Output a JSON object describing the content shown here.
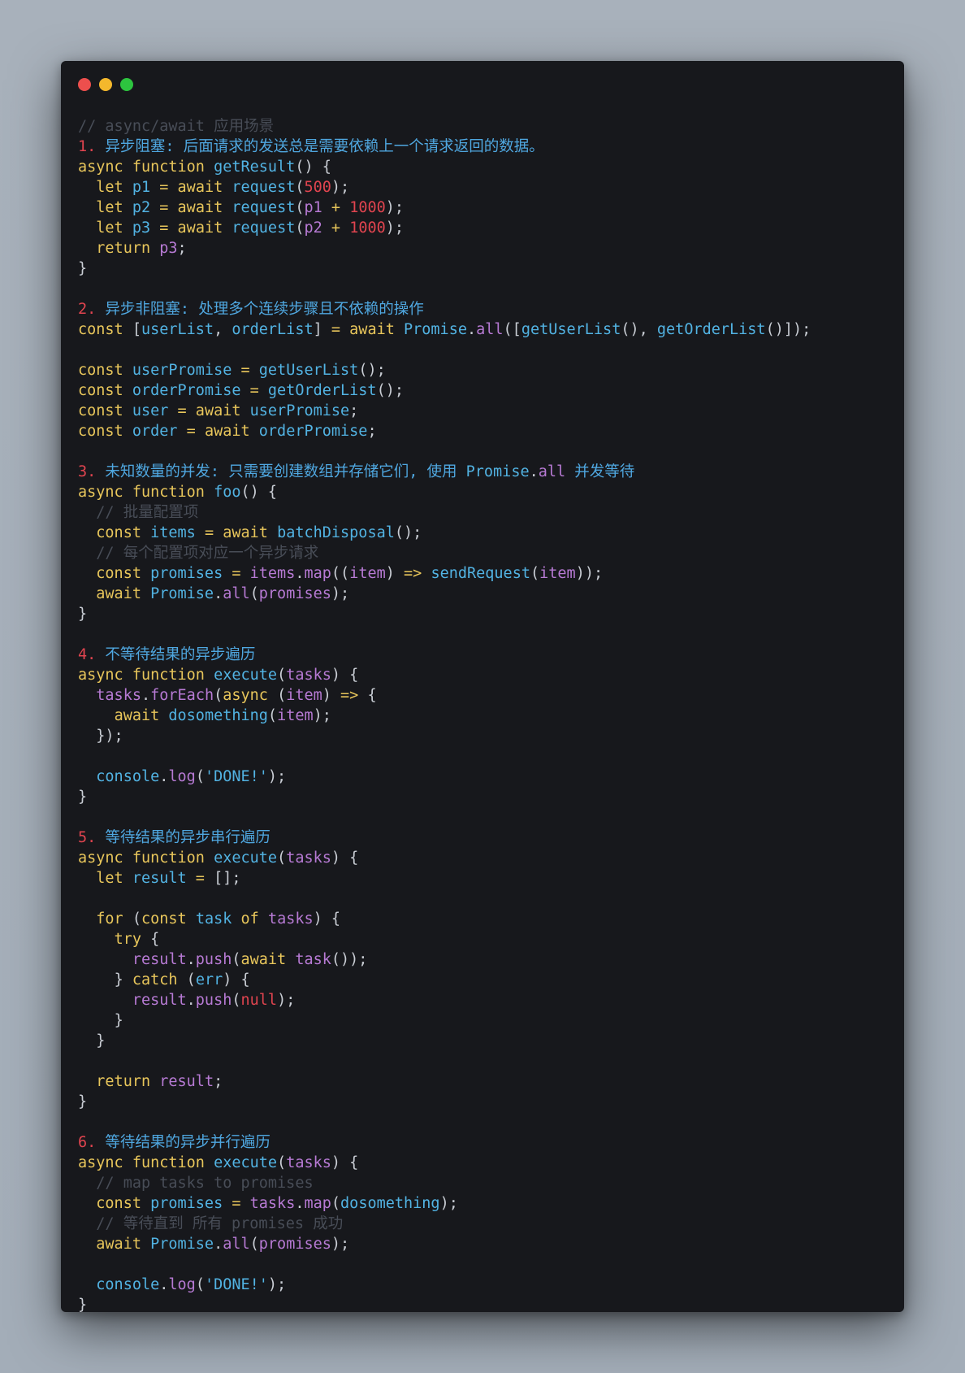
{
  "window": {
    "controls": [
      {
        "name": "close-button",
        "color": "#ed4f4d"
      },
      {
        "name": "minimize-button",
        "color": "#f4b82c"
      },
      {
        "name": "maximize-button",
        "color": "#2dc43f"
      }
    ]
  },
  "colors": {
    "background": "#a6b0ba",
    "editor": "#17181c",
    "comment": "#484d57",
    "keyword": "#e8c65b",
    "function": "#52b3e3",
    "variable": "#b77ad4",
    "number": "#e0444f",
    "heading": "#4fa7e0",
    "string": "#52b3e3",
    "plain": "#c9cdd4"
  },
  "code_lines": [
    [
      [
        "comment",
        "// async/await 应用场景"
      ]
    ],
    [
      [
        "number",
        "1. "
      ],
      [
        "heading",
        "异步阻塞: 后面请求的发送总是需要依赖上一个请求返回的数据。"
      ]
    ],
    [
      [
        "keyword",
        "async function "
      ],
      [
        "function",
        "getResult"
      ],
      [
        "punct",
        "() {"
      ]
    ],
    [
      [
        "plain",
        "  "
      ],
      [
        "keyword",
        "let "
      ],
      [
        "function",
        "p1"
      ],
      [
        "keyword",
        " = await "
      ],
      [
        "function",
        "request"
      ],
      [
        "punct",
        "("
      ],
      [
        "number",
        "500"
      ],
      [
        "punct",
        ");"
      ]
    ],
    [
      [
        "plain",
        "  "
      ],
      [
        "keyword",
        "let "
      ],
      [
        "function",
        "p2"
      ],
      [
        "keyword",
        " = await "
      ],
      [
        "function",
        "request"
      ],
      [
        "punct",
        "("
      ],
      [
        "variable",
        "p1"
      ],
      [
        "keyword",
        " + "
      ],
      [
        "number",
        "1000"
      ],
      [
        "punct",
        ");"
      ]
    ],
    [
      [
        "plain",
        "  "
      ],
      [
        "keyword",
        "let "
      ],
      [
        "function",
        "p3"
      ],
      [
        "keyword",
        " = await "
      ],
      [
        "function",
        "request"
      ],
      [
        "punct",
        "("
      ],
      [
        "variable",
        "p2"
      ],
      [
        "keyword",
        " + "
      ],
      [
        "number",
        "1000"
      ],
      [
        "punct",
        ");"
      ]
    ],
    [
      [
        "plain",
        "  "
      ],
      [
        "keyword",
        "return "
      ],
      [
        "variable",
        "p3"
      ],
      [
        "punct",
        ";"
      ]
    ],
    [
      [
        "punct",
        "}"
      ]
    ],
    [],
    [
      [
        "number",
        "2. "
      ],
      [
        "heading",
        "异步非阻塞: 处理多个连续步骤且不依赖的操作"
      ]
    ],
    [
      [
        "keyword",
        "const "
      ],
      [
        "punct",
        "["
      ],
      [
        "function",
        "userList"
      ],
      [
        "punct",
        ", "
      ],
      [
        "function",
        "orderList"
      ],
      [
        "punct",
        "]"
      ],
      [
        "keyword",
        " = await "
      ],
      [
        "class",
        "Promise"
      ],
      [
        "punct",
        "."
      ],
      [
        "variable",
        "all"
      ],
      [
        "punct",
        "(["
      ],
      [
        "function",
        "getUserList"
      ],
      [
        "punct",
        "(), "
      ],
      [
        "function",
        "getOrderList"
      ],
      [
        "punct",
        "()]);"
      ]
    ],
    [],
    [
      [
        "keyword",
        "const "
      ],
      [
        "function",
        "userPromise"
      ],
      [
        "keyword",
        " = "
      ],
      [
        "function",
        "getUserList"
      ],
      [
        "punct",
        "();"
      ]
    ],
    [
      [
        "keyword",
        "const "
      ],
      [
        "function",
        "orderPromise"
      ],
      [
        "keyword",
        " = "
      ],
      [
        "function",
        "getOrderList"
      ],
      [
        "punct",
        "();"
      ]
    ],
    [
      [
        "keyword",
        "const "
      ],
      [
        "function",
        "user"
      ],
      [
        "keyword",
        " = await "
      ],
      [
        "function",
        "userPromise"
      ],
      [
        "punct",
        ";"
      ]
    ],
    [
      [
        "keyword",
        "const "
      ],
      [
        "function",
        "order"
      ],
      [
        "keyword",
        " = await "
      ],
      [
        "function",
        "orderPromise"
      ],
      [
        "punct",
        ";"
      ]
    ],
    [],
    [
      [
        "number",
        "3. "
      ],
      [
        "heading",
        "未知数量的并发: 只需要创建数组并存储它们, 使用 "
      ],
      [
        "class",
        "Promise"
      ],
      [
        "punct",
        "."
      ],
      [
        "variable",
        "all"
      ],
      [
        "heading",
        " 并发等待"
      ]
    ],
    [
      [
        "keyword",
        "async function "
      ],
      [
        "function",
        "foo"
      ],
      [
        "punct",
        "() {"
      ]
    ],
    [
      [
        "plain",
        "  "
      ],
      [
        "comment",
        "// 批量配置项"
      ]
    ],
    [
      [
        "plain",
        "  "
      ],
      [
        "keyword",
        "const "
      ],
      [
        "function",
        "items"
      ],
      [
        "keyword",
        " = await "
      ],
      [
        "function",
        "batchDisposal"
      ],
      [
        "punct",
        "();"
      ]
    ],
    [
      [
        "plain",
        "  "
      ],
      [
        "comment",
        "// 每个配置项对应一个异步请求"
      ]
    ],
    [
      [
        "plain",
        "  "
      ],
      [
        "keyword",
        "const "
      ],
      [
        "function",
        "promises"
      ],
      [
        "keyword",
        " = "
      ],
      [
        "variable",
        "items"
      ],
      [
        "punct",
        "."
      ],
      [
        "variable",
        "map"
      ],
      [
        "punct",
        "(("
      ],
      [
        "variable",
        "item"
      ],
      [
        "punct",
        ") "
      ],
      [
        "keyword",
        "=> "
      ],
      [
        "function",
        "sendRequest"
      ],
      [
        "punct",
        "("
      ],
      [
        "variable",
        "item"
      ],
      [
        "punct",
        "));"
      ]
    ],
    [
      [
        "plain",
        "  "
      ],
      [
        "keyword",
        "await "
      ],
      [
        "class",
        "Promise"
      ],
      [
        "punct",
        "."
      ],
      [
        "variable",
        "all"
      ],
      [
        "punct",
        "("
      ],
      [
        "variable",
        "promises"
      ],
      [
        "punct",
        ");"
      ]
    ],
    [
      [
        "punct",
        "}"
      ]
    ],
    [],
    [
      [
        "number",
        "4. "
      ],
      [
        "heading",
        "不等待结果的异步遍历"
      ]
    ],
    [
      [
        "keyword",
        "async function "
      ],
      [
        "function",
        "execute"
      ],
      [
        "punct",
        "("
      ],
      [
        "variable",
        "tasks"
      ],
      [
        "punct",
        ") {"
      ]
    ],
    [
      [
        "plain",
        "  "
      ],
      [
        "variable",
        "tasks"
      ],
      [
        "punct",
        "."
      ],
      [
        "variable",
        "forEach"
      ],
      [
        "punct",
        "("
      ],
      [
        "keyword",
        "async "
      ],
      [
        "punct",
        "("
      ],
      [
        "variable",
        "item"
      ],
      [
        "punct",
        ") "
      ],
      [
        "keyword",
        "=> "
      ],
      [
        "punct",
        "{"
      ]
    ],
    [
      [
        "plain",
        "    "
      ],
      [
        "keyword",
        "await "
      ],
      [
        "function",
        "dosomething"
      ],
      [
        "punct",
        "("
      ],
      [
        "variable",
        "item"
      ],
      [
        "punct",
        ");"
      ]
    ],
    [
      [
        "plain",
        "  "
      ],
      [
        "punct",
        "});"
      ]
    ],
    [],
    [
      [
        "plain",
        "  "
      ],
      [
        "function",
        "console"
      ],
      [
        "punct",
        "."
      ],
      [
        "variable",
        "log"
      ],
      [
        "punct",
        "("
      ],
      [
        "string",
        "'DONE!'"
      ],
      [
        "punct",
        ");"
      ]
    ],
    [
      [
        "punct",
        "}"
      ]
    ],
    [],
    [
      [
        "number",
        "5. "
      ],
      [
        "heading",
        "等待结果的异步串行遍历"
      ]
    ],
    [
      [
        "keyword",
        "async function "
      ],
      [
        "function",
        "execute"
      ],
      [
        "punct",
        "("
      ],
      [
        "variable",
        "tasks"
      ],
      [
        "punct",
        ") {"
      ]
    ],
    [
      [
        "plain",
        "  "
      ],
      [
        "keyword",
        "let "
      ],
      [
        "function",
        "result"
      ],
      [
        "keyword",
        " = "
      ],
      [
        "punct",
        "[];"
      ]
    ],
    [],
    [
      [
        "plain",
        "  "
      ],
      [
        "keyword",
        "for "
      ],
      [
        "punct",
        "("
      ],
      [
        "keyword",
        "const "
      ],
      [
        "function",
        "task"
      ],
      [
        "keyword",
        " of "
      ],
      [
        "variable",
        "tasks"
      ],
      [
        "punct",
        ") {"
      ]
    ],
    [
      [
        "plain",
        "    "
      ],
      [
        "keyword",
        "try "
      ],
      [
        "punct",
        "{"
      ]
    ],
    [
      [
        "plain",
        "      "
      ],
      [
        "variable",
        "result"
      ],
      [
        "punct",
        "."
      ],
      [
        "variable",
        "push"
      ],
      [
        "punct",
        "("
      ],
      [
        "keyword",
        "await "
      ],
      [
        "variable",
        "task"
      ],
      [
        "punct",
        "());"
      ]
    ],
    [
      [
        "plain",
        "    "
      ],
      [
        "punct",
        "} "
      ],
      [
        "keyword",
        "catch "
      ],
      [
        "punct",
        "("
      ],
      [
        "function",
        "err"
      ],
      [
        "punct",
        ") {"
      ]
    ],
    [
      [
        "plain",
        "      "
      ],
      [
        "variable",
        "result"
      ],
      [
        "punct",
        "."
      ],
      [
        "variable",
        "push"
      ],
      [
        "punct",
        "("
      ],
      [
        "null",
        "null"
      ],
      [
        "punct",
        ");"
      ]
    ],
    [
      [
        "plain",
        "    "
      ],
      [
        "punct",
        "}"
      ]
    ],
    [
      [
        "plain",
        "  "
      ],
      [
        "punct",
        "}"
      ]
    ],
    [],
    [
      [
        "plain",
        "  "
      ],
      [
        "keyword",
        "return "
      ],
      [
        "variable",
        "result"
      ],
      [
        "punct",
        ";"
      ]
    ],
    [
      [
        "punct",
        "}"
      ]
    ],
    [],
    [
      [
        "number",
        "6. "
      ],
      [
        "heading",
        "等待结果的异步并行遍历"
      ]
    ],
    [
      [
        "keyword",
        "async function "
      ],
      [
        "function",
        "execute"
      ],
      [
        "punct",
        "("
      ],
      [
        "variable",
        "tasks"
      ],
      [
        "punct",
        ") {"
      ]
    ],
    [
      [
        "plain",
        "  "
      ],
      [
        "comment",
        "// map tasks to promises"
      ]
    ],
    [
      [
        "plain",
        "  "
      ],
      [
        "keyword",
        "const "
      ],
      [
        "function",
        "promises"
      ],
      [
        "keyword",
        " = "
      ],
      [
        "variable",
        "tasks"
      ],
      [
        "punct",
        "."
      ],
      [
        "variable",
        "map"
      ],
      [
        "punct",
        "("
      ],
      [
        "function",
        "dosomething"
      ],
      [
        "punct",
        ");"
      ]
    ],
    [
      [
        "plain",
        "  "
      ],
      [
        "comment",
        "// 等待直到 所有 promises 成功"
      ]
    ],
    [
      [
        "plain",
        "  "
      ],
      [
        "keyword",
        "await "
      ],
      [
        "class",
        "Promise"
      ],
      [
        "punct",
        "."
      ],
      [
        "variable",
        "all"
      ],
      [
        "punct",
        "("
      ],
      [
        "variable",
        "promises"
      ],
      [
        "punct",
        ");"
      ]
    ],
    [],
    [
      [
        "plain",
        "  "
      ],
      [
        "function",
        "console"
      ],
      [
        "punct",
        "."
      ],
      [
        "variable",
        "log"
      ],
      [
        "punct",
        "("
      ],
      [
        "string",
        "'DONE!'"
      ],
      [
        "punct",
        ");"
      ]
    ],
    [
      [
        "punct",
        "}"
      ]
    ]
  ]
}
